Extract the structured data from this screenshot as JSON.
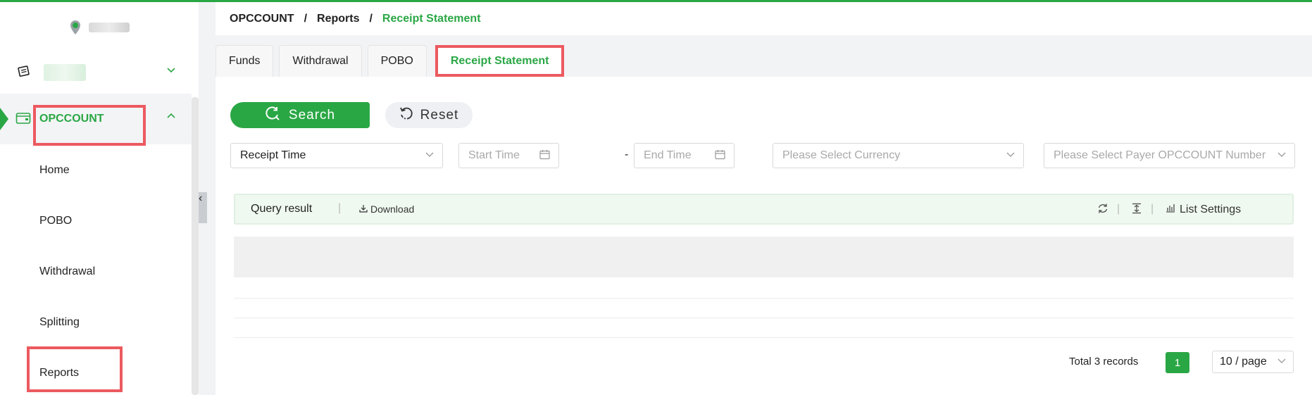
{
  "sidebar": {
    "section_label": "OPCCOUNT",
    "items": [
      {
        "label": "Home"
      },
      {
        "label": "POBO"
      },
      {
        "label": "Withdrawal"
      },
      {
        "label": "Splitting"
      },
      {
        "label": "Reports"
      }
    ],
    "collapse_glyph": "‹"
  },
  "breadcrumb": {
    "items": [
      "OPCCOUNT",
      "Reports",
      "Receipt Statement"
    ],
    "separator": "/"
  },
  "tabs": [
    {
      "label": "Funds"
    },
    {
      "label": "Withdrawal"
    },
    {
      "label": "POBO"
    },
    {
      "label": "Receipt Statement",
      "active": true
    }
  ],
  "actions": {
    "search_label": "Search",
    "reset_label": "Reset"
  },
  "filters": {
    "time_type": "Receipt Time",
    "start_time_placeholder": "Start Time",
    "range_sep": "-",
    "end_time_placeholder": "End Time",
    "currency_placeholder": "Please Select Currency",
    "payer_placeholder": "Please Select Payer OPCCOUNT Number"
  },
  "result": {
    "title": "Query result",
    "divider": "|",
    "download_label": "Download",
    "list_settings_label": "List Settings"
  },
  "pagination": {
    "total_text": "Total 3 records",
    "current_page": "1",
    "page_size": "10 / page"
  },
  "colors": {
    "accent": "#2aa745",
    "highlight_box": "#ec5a60"
  },
  "icons": {
    "logo": "map-pin-icon",
    "top_item": "note-icon",
    "section": "wallet-icon",
    "search": "refresh-search-icon",
    "reset": "reset-icon",
    "calendar": "calendar-icon",
    "download": "download-icon",
    "refresh": "refresh-icon",
    "density": "density-icon",
    "list_settings": "bar-chart-icon"
  }
}
